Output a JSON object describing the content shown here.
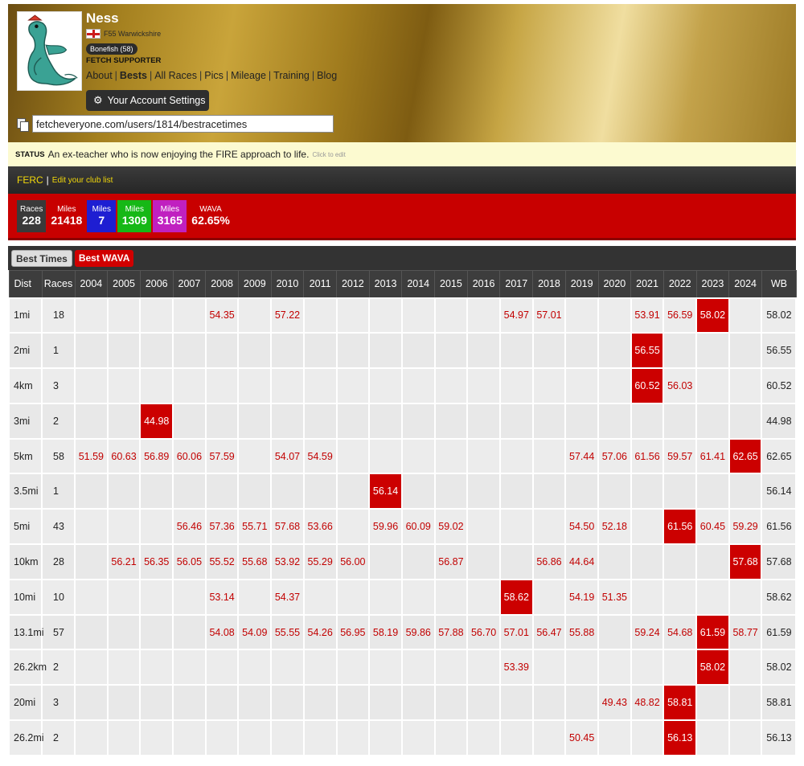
{
  "profile": {
    "name": "Ness",
    "category": "F55 Warwickshire",
    "badge": "Bonefish (58)",
    "supporter": "FETCH SUPPORTER",
    "nav": [
      {
        "label": "About",
        "active": false
      },
      {
        "label": "Bests",
        "active": true
      },
      {
        "label": "All Races",
        "active": false
      },
      {
        "label": "Pics",
        "active": false
      },
      {
        "label": "Mileage",
        "active": false
      },
      {
        "label": "Training",
        "active": false
      },
      {
        "label": "Blog",
        "active": false
      }
    ],
    "account_button": "Your Account Settings",
    "profile_url": "fetcheveryone.com/users/1814/bestracetimes"
  },
  "status": {
    "label": "STATUS",
    "text": "An ex-teacher who is now enjoying the FIRE approach to life.",
    "hint": "Click to edit"
  },
  "club": {
    "name": "FERC",
    "edit_label": "Edit your club list"
  },
  "stats": {
    "races": {
      "label": "Races",
      "value": "228"
    },
    "miles_total": {
      "label": "Miles",
      "value": "21418"
    },
    "miles_blue": {
      "label": "Miles",
      "value": "7"
    },
    "miles_green": {
      "label": "Miles",
      "value": "1309"
    },
    "miles_magenta": {
      "label": "Miles",
      "value": "3165"
    },
    "wava": {
      "label": "WAVA",
      "value": "62.65%"
    }
  },
  "tabs": {
    "best_times": "Best Times",
    "best_wava": "Best WAVA"
  },
  "table": {
    "headers": [
      "Dist",
      "Races",
      "2004",
      "2005",
      "2006",
      "2007",
      "2008",
      "2009",
      "2010",
      "2011",
      "2012",
      "2013",
      "2014",
      "2015",
      "2016",
      "2017",
      "2018",
      "2019",
      "2020",
      "2021",
      "2022",
      "2023",
      "2024",
      "WB"
    ],
    "rows": [
      {
        "dist": "1mi",
        "races": "18",
        "values": [
          "",
          "",
          "",
          "",
          "54.35",
          "",
          "57.22",
          "",
          "",
          "",
          "",
          "",
          "",
          "54.97",
          "57.01",
          "",
          "",
          "53.91",
          "56.59",
          "58.02",
          ""
        ],
        "best": 19,
        "wb": "58.02"
      },
      {
        "dist": "2mi",
        "races": "1",
        "values": [
          "",
          "",
          "",
          "",
          "",
          "",
          "",
          "",
          "",
          "",
          "",
          "",
          "",
          "",
          "",
          "",
          "",
          "56.55",
          "",
          "",
          ""
        ],
        "best": 17,
        "wb": "56.55"
      },
      {
        "dist": "4km",
        "races": "3",
        "values": [
          "",
          "",
          "",
          "",
          "",
          "",
          "",
          "",
          "",
          "",
          "",
          "",
          "",
          "",
          "",
          "",
          "",
          "60.52",
          "56.03",
          "",
          ""
        ],
        "best": 17,
        "wb": "60.52"
      },
      {
        "dist": "3mi",
        "races": "2",
        "values": [
          "",
          "",
          "44.98",
          "",
          "",
          "",
          "",
          "",
          "",
          "",
          "",
          "",
          "",
          "",
          "",
          "",
          "",
          "",
          "",
          "",
          ""
        ],
        "best": 2,
        "wb": "44.98"
      },
      {
        "dist": "5km",
        "races": "58",
        "values": [
          "51.59",
          "60.63",
          "56.89",
          "60.06",
          "57.59",
          "",
          "54.07",
          "54.59",
          "",
          "",
          "",
          "",
          "",
          "",
          "",
          "57.44",
          "57.06",
          "61.56",
          "59.57",
          "61.41",
          "62.65"
        ],
        "best": 20,
        "wb": "62.65"
      },
      {
        "dist": "3.5mi",
        "races": "1",
        "values": [
          "",
          "",
          "",
          "",
          "",
          "",
          "",
          "",
          "",
          "56.14",
          "",
          "",
          "",
          "",
          "",
          "",
          "",
          "",
          "",
          "",
          ""
        ],
        "best": 9,
        "wb": "56.14"
      },
      {
        "dist": "5mi",
        "races": "43",
        "values": [
          "",
          "",
          "",
          "56.46",
          "57.36",
          "55.71",
          "57.68",
          "53.66",
          "",
          "59.96",
          "60.09",
          "59.02",
          "",
          "",
          "",
          "54.50",
          "52.18",
          "",
          "61.56",
          "60.45",
          "59.29"
        ],
        "best": 18,
        "wb": "61.56"
      },
      {
        "dist": "10km",
        "races": "28",
        "values": [
          "",
          "56.21",
          "56.35",
          "56.05",
          "55.52",
          "55.68",
          "53.92",
          "55.29",
          "56.00",
          "",
          "",
          "56.87",
          "",
          "",
          "56.86",
          "44.64",
          "",
          "",
          "",
          "",
          "57.68"
        ],
        "best": 20,
        "wb": "57.68"
      },
      {
        "dist": "10mi",
        "races": "10",
        "values": [
          "",
          "",
          "",
          "",
          "53.14",
          "",
          "54.37",
          "",
          "",
          "",
          "",
          "",
          "",
          "58.62",
          "",
          "54.19",
          "51.35",
          "",
          "",
          "",
          ""
        ],
        "best": 13,
        "wb": "58.62"
      },
      {
        "dist": "13.1mi",
        "races": "57",
        "values": [
          "",
          "",
          "",
          "",
          "54.08",
          "54.09",
          "55.55",
          "54.26",
          "56.95",
          "58.19",
          "59.86",
          "57.88",
          "56.70",
          "57.01",
          "56.47",
          "55.88",
          "",
          "59.24",
          "54.68",
          "61.59",
          "58.77"
        ],
        "best": 19,
        "wb": "61.59"
      },
      {
        "dist": "26.2km",
        "races": "2",
        "values": [
          "",
          "",
          "",
          "",
          "",
          "",
          "",
          "",
          "",
          "",
          "",
          "",
          "",
          "53.39",
          "",
          "",
          "",
          "",
          "",
          "58.02",
          ""
        ],
        "best": 19,
        "wb": "58.02"
      },
      {
        "dist": "20mi",
        "races": "3",
        "values": [
          "",
          "",
          "",
          "",
          "",
          "",
          "",
          "",
          "",
          "",
          "",
          "",
          "",
          "",
          "",
          "",
          "49.43",
          "48.82",
          "58.81",
          "",
          ""
        ],
        "best": 18,
        "wb": "58.81"
      },
      {
        "dist": "26.2mi",
        "races": "2",
        "values": [
          "",
          "",
          "",
          "",
          "",
          "",
          "",
          "",
          "",
          "",
          "",
          "",
          "",
          "",
          "",
          "50.45",
          "",
          "",
          "56.13",
          "",
          ""
        ],
        "best": 18,
        "wb": "56.13"
      }
    ]
  }
}
